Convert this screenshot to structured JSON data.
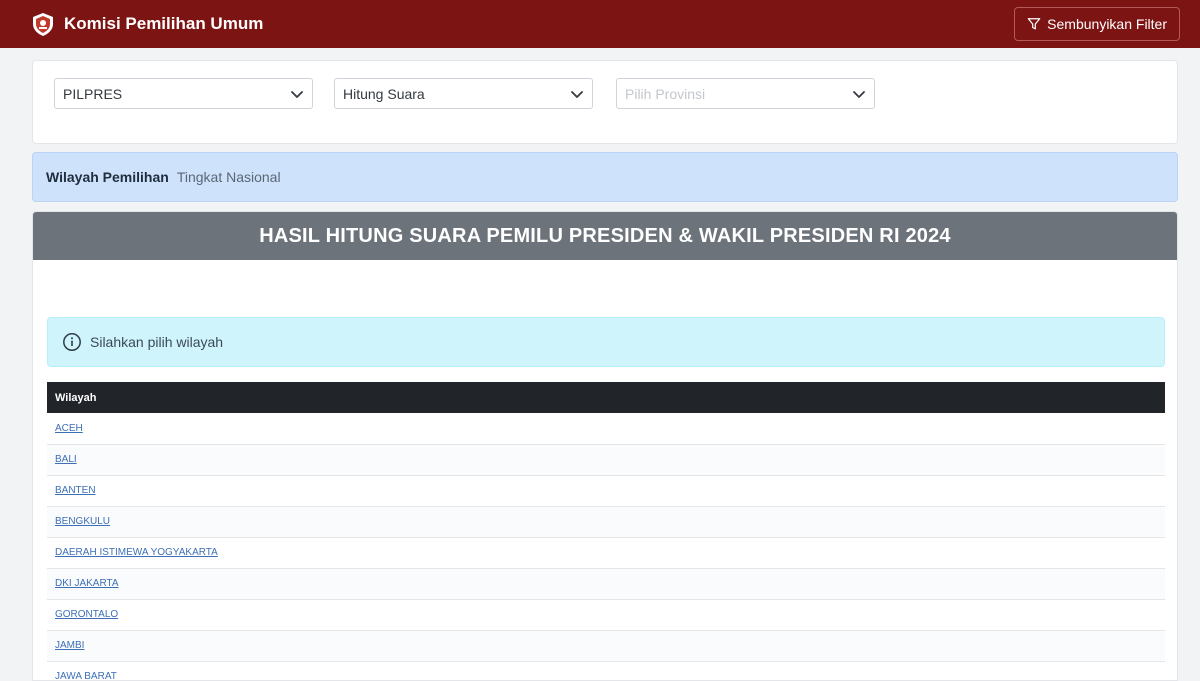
{
  "navbar": {
    "brand_title": "Komisi Pemilihan Umum",
    "filter_button_label": "Sembunyikan Filter",
    "logo_icon": "kpu-logo-icon",
    "filter_icon": "filter-icon",
    "background_color": "#7d1414"
  },
  "filters": {
    "election_type": {
      "value": "PILPRES"
    },
    "count_type": {
      "value": "Hitung Suara"
    },
    "province": {
      "placeholder": "Pilih Provinsi"
    }
  },
  "region": {
    "label": "Wilayah Pemilihan",
    "value": "Tingkat Nasional"
  },
  "results": {
    "title": "HASIL HITUNG SUARA PEMILU PRESIDEN & WAKIL PRESIDEN RI 2024",
    "alert_text": "Silahkan pilih wilayah",
    "alert_icon": "info-icon",
    "table_header": "Wilayah",
    "rows": [
      "ACEH",
      "BALI",
      "BANTEN",
      "BENGKULU",
      "DAERAH ISTIMEWA YOGYAKARTA",
      "DKI JAKARTA",
      "GORONTALO",
      "JAMBI",
      "JAWA BARAT"
    ]
  }
}
